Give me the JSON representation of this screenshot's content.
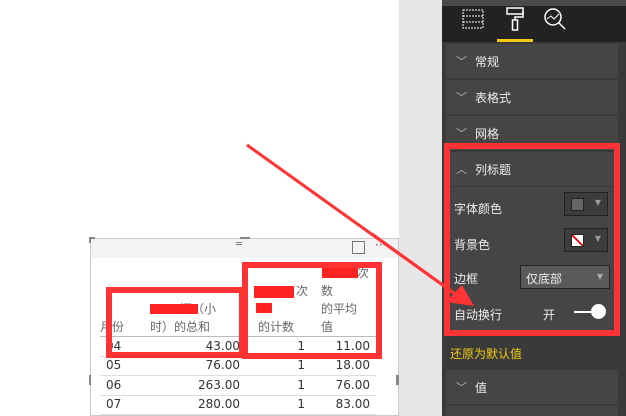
{
  "panel": {
    "tabs": [
      "fields-icon",
      "format-icon",
      "analytics-icon"
    ],
    "sections": [
      {
        "label": "常规",
        "expanded": false
      },
      {
        "label": "表格式",
        "expanded": false
      },
      {
        "label": "网格",
        "expanded": false
      },
      {
        "label": "列标题",
        "expanded": true
      },
      {
        "label": "值",
        "expanded": false
      }
    ],
    "column_header": {
      "font_color_label": "字体颜色",
      "font_color": "#666666",
      "background_label": "背景色",
      "border_label": "边框",
      "border_value": "仅底部",
      "wrap_label": "自动换行",
      "wrap_state": "开",
      "wrap_on": true
    },
    "reset_label": "还原为默认值",
    "accent": "#f2c811"
  },
  "table": {
    "headers": [
      {
        "lines": [
          "月份"
        ]
      },
      {
        "lines": [
          "间（小",
          "时）的总和"
        ]
      },
      {
        "lines": [
          "次",
          "",
          "的计数"
        ]
      },
      {
        "lines": [
          "",
          "数",
          "的平均",
          "值"
        ]
      }
    ],
    "rows": [
      [
        "04",
        "43.00",
        "1",
        "11.00"
      ],
      [
        "05",
        "76.00",
        "1",
        "18.00"
      ],
      [
        "06",
        "263.00",
        "1",
        "76.00"
      ],
      [
        "07",
        "280.00",
        "1",
        "83.00"
      ]
    ]
  },
  "annotation_color": "#ff3333"
}
